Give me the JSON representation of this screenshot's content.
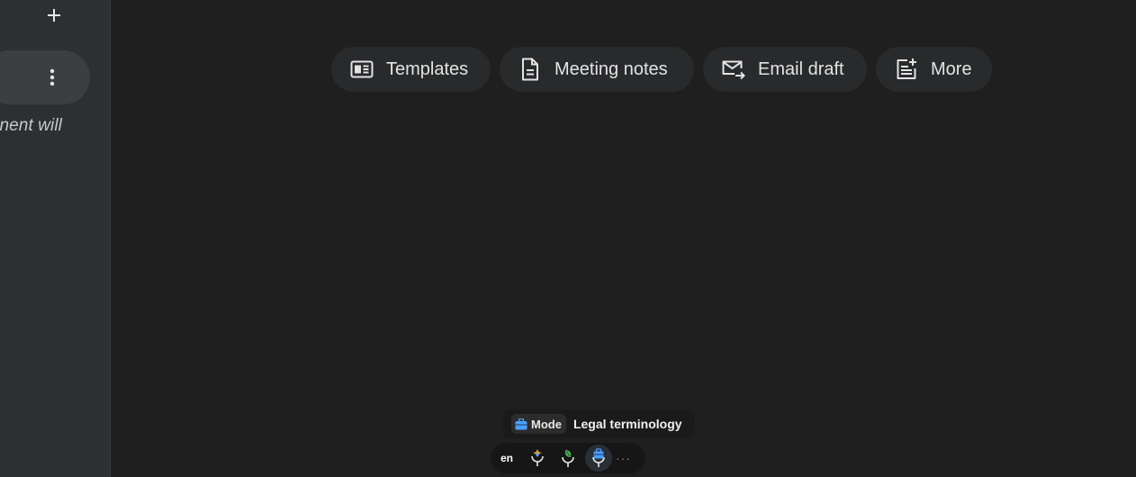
{
  "sidebar": {
    "add_icon": "plus-icon",
    "menu_icon": "more-vertical-icon",
    "snippet_text": "nent will"
  },
  "suggestion_chips": [
    {
      "label": "Templates",
      "icon": "templates-icon"
    },
    {
      "label": "Meeting notes",
      "icon": "document-icon"
    },
    {
      "label": "Email draft",
      "icon": "email-forward-icon"
    },
    {
      "label": "More",
      "icon": "note-add-icon"
    }
  ],
  "mode": {
    "badge_label": "Mode",
    "value": "Legal terminology",
    "icon": "briefcase-icon"
  },
  "toolbar": {
    "language": "en",
    "buttons": [
      "mic-sparkle-icon",
      "mic-leaf-icon",
      "mic-briefcase-icon"
    ],
    "more": "···"
  },
  "colors": {
    "background": "#1f1f1f",
    "sidebar": "#2d3033",
    "chip": "#282a2c",
    "accent_blue": "#4a9eff",
    "accent_green": "#4caf50",
    "accent_orange": "#f5a623"
  }
}
